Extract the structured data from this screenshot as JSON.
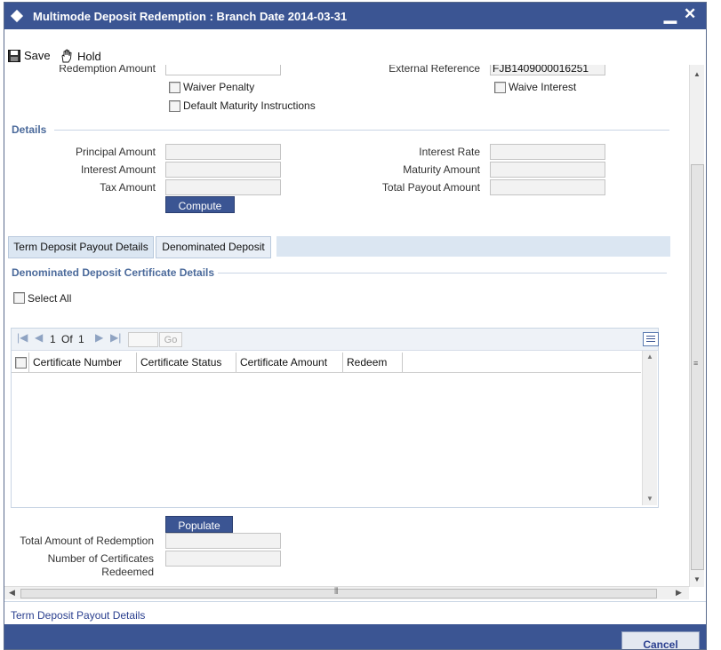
{
  "window": {
    "title": "Multimode Deposit Redemption : Branch Date 2014-03-31",
    "minimize": "▁",
    "close": "✕"
  },
  "toolbar": {
    "save_label": "Save",
    "hold_label": "Hold"
  },
  "top": {
    "redemption_amount_label": "Redemption Amount",
    "external_reference_label": "External Reference",
    "external_reference_value": "FJB1409000016251",
    "waiver_penalty_label": "Waiver Penalty",
    "waive_interest_label": "Waive Interest",
    "default_maturity_label": "Default Maturity Instructions"
  },
  "details": {
    "section_label": "Details",
    "principal_amount_label": "Principal Amount",
    "interest_amount_label": "Interest Amount",
    "tax_amount_label": "Tax Amount",
    "interest_rate_label": "Interest Rate",
    "maturity_amount_label": "Maturity Amount",
    "total_payout_label": "Total Payout Amount",
    "compute_label": "Compute"
  },
  "tabs": [
    {
      "label": "Term Deposit Payout Details"
    },
    {
      "label": "Denominated Deposit"
    }
  ],
  "certificates": {
    "section_label": "Denominated Deposit Certificate Details",
    "select_all_label": "Select All",
    "pager": {
      "page": "1",
      "of_label": "Of",
      "total": "1",
      "go_label": "Go"
    },
    "columns": [
      "Certificate Number",
      "Certificate Status",
      "Certificate Amount",
      "Redeem"
    ],
    "populate_label": "Populate",
    "total_redemption_label": "Total Amount of Redemption",
    "num_certificates_label_1": "Number of Certificates",
    "num_certificates_label_2": "Redeemed"
  },
  "footer": {
    "link_label": "Term Deposit Payout Details",
    "cancel_label": "Cancel"
  },
  "colors": {
    "titlebar": "#3b5593",
    "section_text": "#4b6a9b",
    "tab_bg": "#dbe6f2"
  }
}
